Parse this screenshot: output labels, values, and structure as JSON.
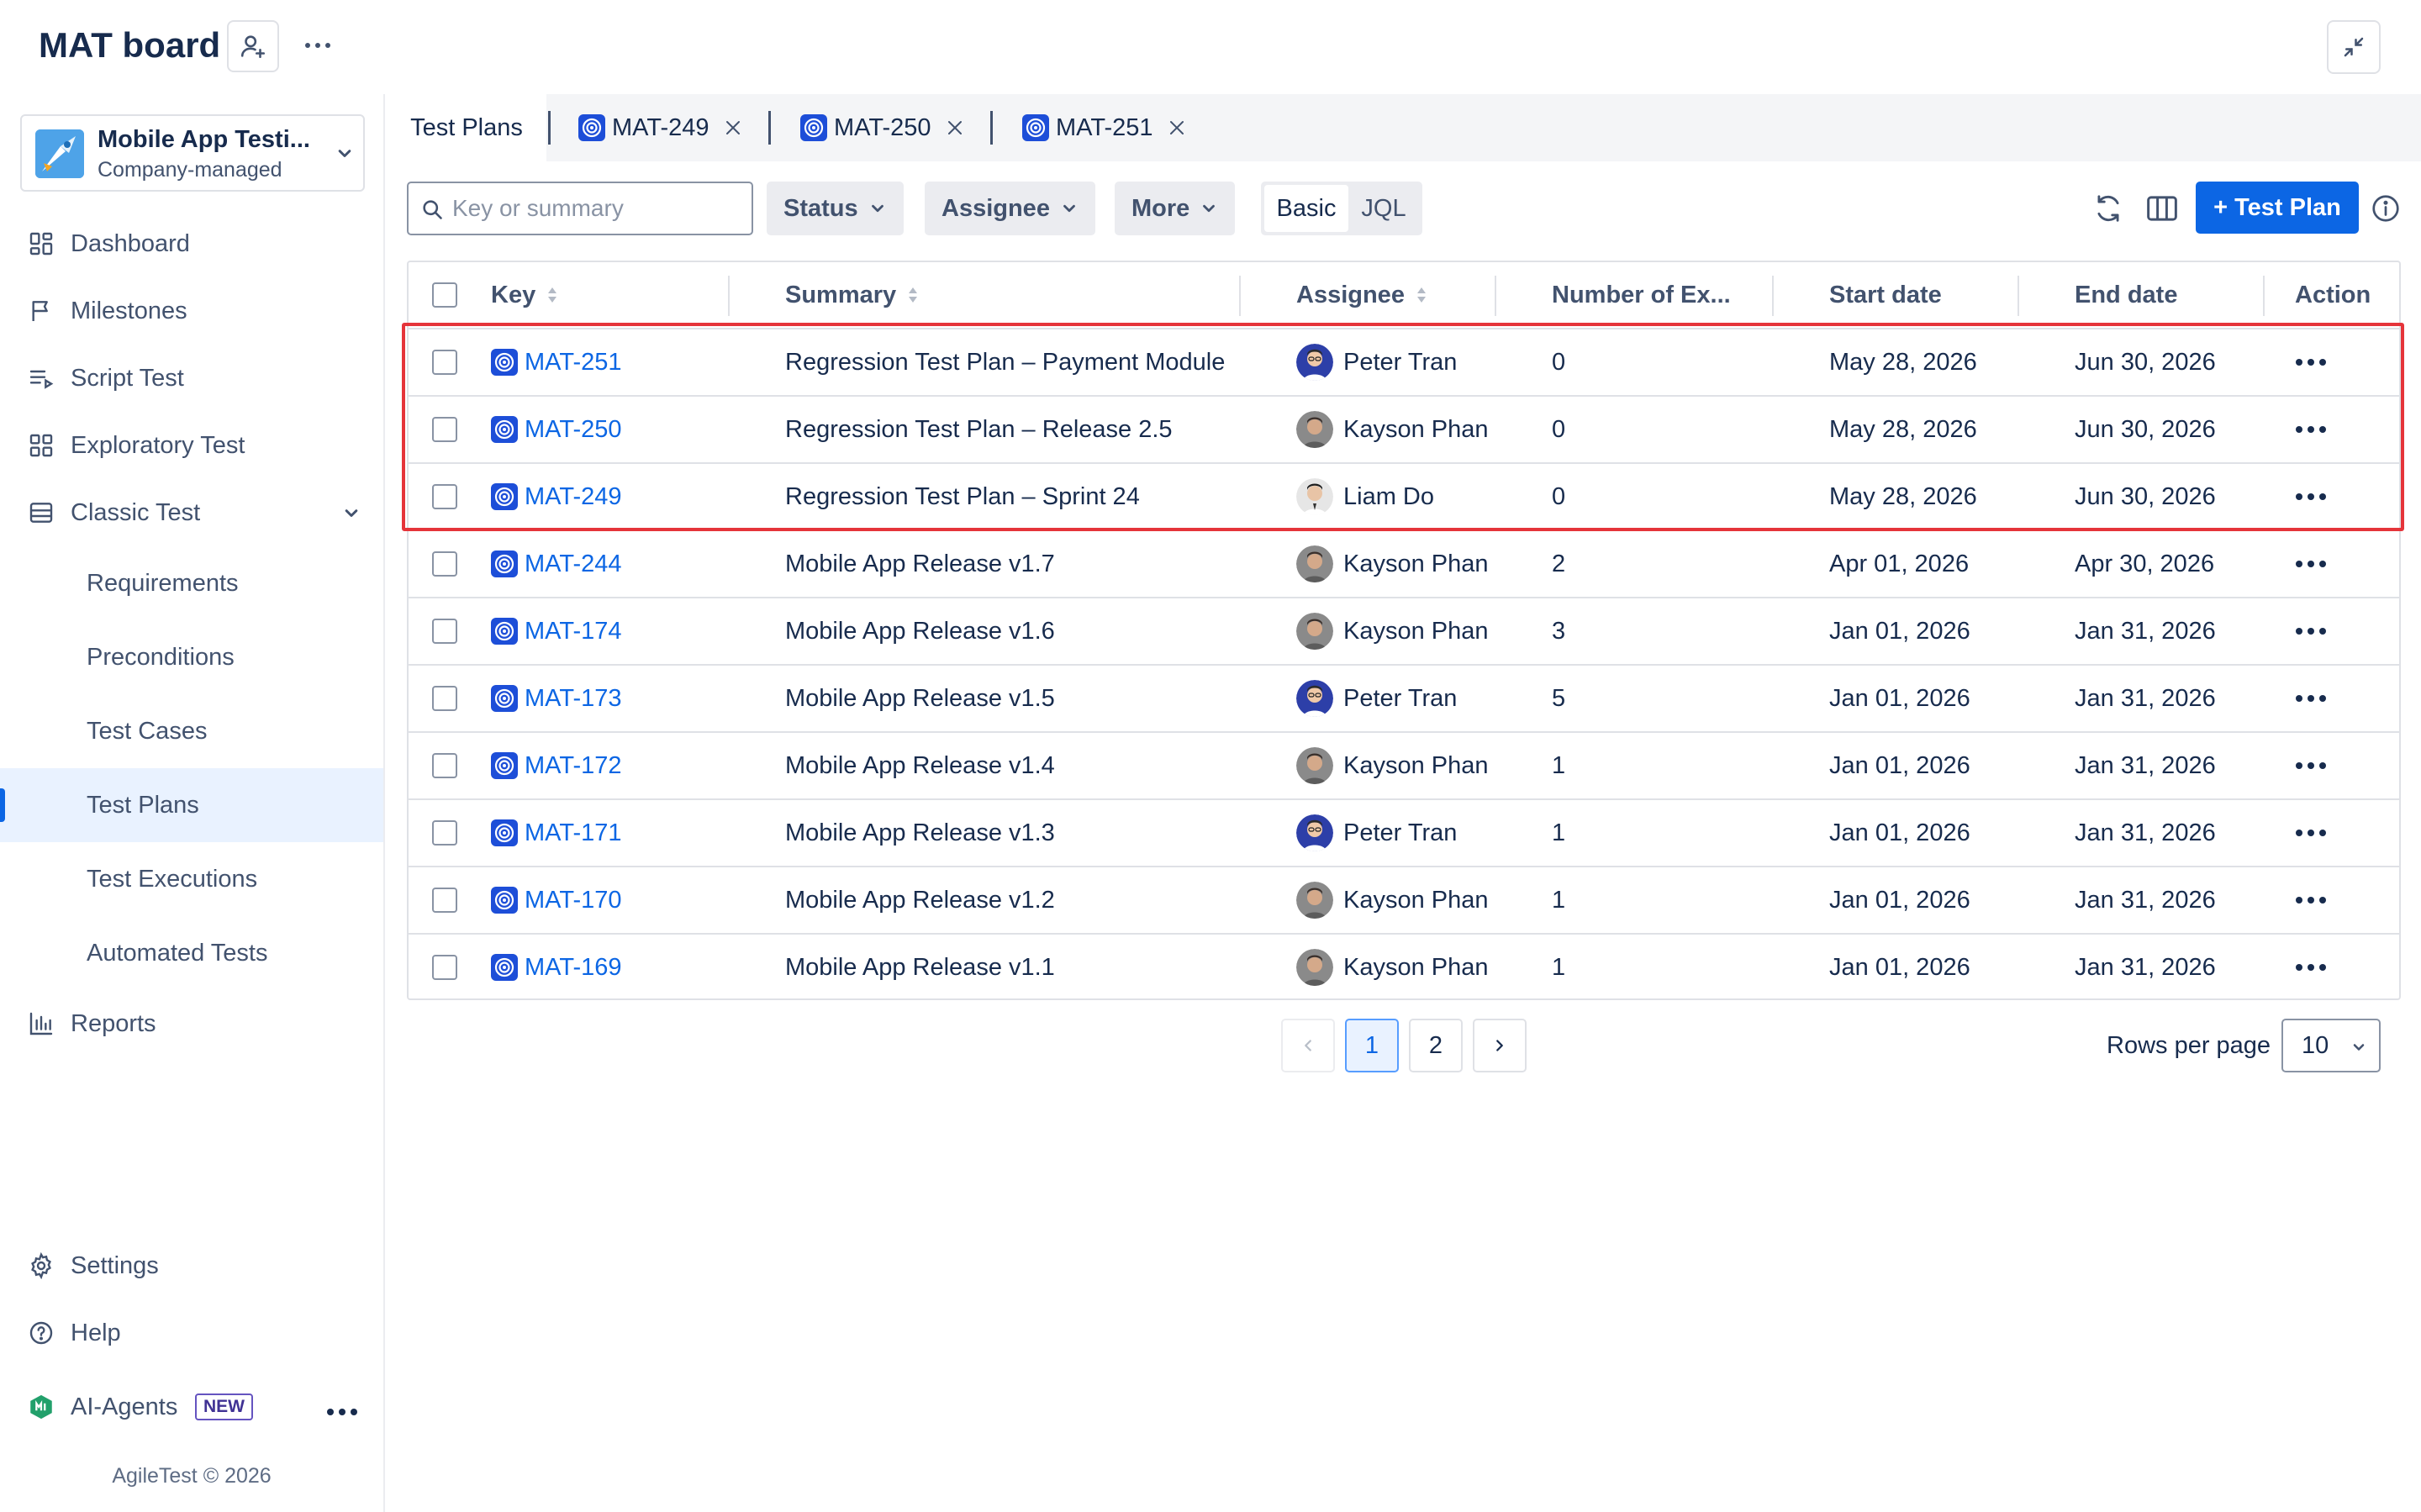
{
  "header": {
    "board_title": "MAT board"
  },
  "project": {
    "name": "Mobile App Testi...",
    "type": "Company-managed"
  },
  "sidebar": {
    "items": [
      {
        "label": "Dashboard",
        "icon": "dashboard-icon"
      },
      {
        "label": "Milestones",
        "icon": "flag-icon"
      },
      {
        "label": "Script Test",
        "icon": "list-icon"
      },
      {
        "label": "Exploratory Test",
        "icon": "grid-icon"
      },
      {
        "label": "Classic Test",
        "icon": "table-icon"
      },
      {
        "label": "Requirements"
      },
      {
        "label": "Preconditions"
      },
      {
        "label": "Test Cases"
      },
      {
        "label": "Test Plans"
      },
      {
        "label": "Test Executions"
      },
      {
        "label": "Automated Tests"
      },
      {
        "label": "Reports",
        "icon": "chart-icon"
      },
      {
        "label": "Settings",
        "icon": "gear-icon"
      },
      {
        "label": "Help",
        "icon": "help-icon"
      },
      {
        "label": "AI-Agents",
        "icon": "ai-agents-icon"
      }
    ],
    "active_item": "Test Plans",
    "new_badge": "NEW",
    "footer": "AgileTest © 2026"
  },
  "tabs": [
    {
      "label": "Test Plans",
      "closable": false
    },
    {
      "label": "MAT-249",
      "closable": true
    },
    {
      "label": "MAT-250",
      "closable": true
    },
    {
      "label": "MAT-251",
      "closable": true
    }
  ],
  "toolbar": {
    "search_placeholder": "Key or summary",
    "filters": [
      "Status",
      "Assignee",
      "More"
    ],
    "mode_basic": "Basic",
    "mode_jql": "JQL",
    "selected_mode": "Basic",
    "primary_button": "+ Test Plan"
  },
  "table": {
    "columns": [
      "Key",
      "Summary",
      "Assignee",
      "Number of Ex...",
      "Start date",
      "End date",
      "Action"
    ],
    "rows": [
      {
        "key": "MAT-251",
        "summary": "Regression Test Plan – Payment Module",
        "assignee": "Peter Tran",
        "executions": "0",
        "start": "May 28, 2026",
        "end": "Jun 30, 2026",
        "highlighted": true
      },
      {
        "key": "MAT-250",
        "summary": "Regression Test Plan – Release 2.5",
        "assignee": "Kayson Phan",
        "executions": "0",
        "start": "May 28, 2026",
        "end": "Jun 30, 2026",
        "highlighted": true
      },
      {
        "key": "MAT-249",
        "summary": "Regression Test Plan – Sprint 24",
        "assignee": "Liam Do",
        "executions": "0",
        "start": "May 28, 2026",
        "end": "Jun 30, 2026",
        "highlighted": true
      },
      {
        "key": "MAT-244",
        "summary": "Mobile App Release v1.7",
        "assignee": "Kayson Phan",
        "executions": "2",
        "start": "Apr 01, 2026",
        "end": "Apr 30, 2026",
        "highlighted": false
      },
      {
        "key": "MAT-174",
        "summary": "Mobile App Release v1.6",
        "assignee": "Kayson Phan",
        "executions": "3",
        "start": "Jan 01, 2026",
        "end": "Jan 31, 2026",
        "highlighted": false
      },
      {
        "key": "MAT-173",
        "summary": "Mobile App Release v1.5",
        "assignee": "Peter Tran",
        "executions": "5",
        "start": "Jan 01, 2026",
        "end": "Jan 31, 2026",
        "highlighted": false
      },
      {
        "key": "MAT-172",
        "summary": "Mobile App Release v1.4",
        "assignee": "Kayson Phan",
        "executions": "1",
        "start": "Jan 01, 2026",
        "end": "Jan 31, 2026",
        "highlighted": false
      },
      {
        "key": "MAT-171",
        "summary": "Mobile App Release v1.3",
        "assignee": "Peter Tran",
        "executions": "1",
        "start": "Jan 01, 2026",
        "end": "Jan 31, 2026",
        "highlighted": false
      },
      {
        "key": "MAT-170",
        "summary": "Mobile App Release v1.2",
        "assignee": "Kayson Phan",
        "executions": "1",
        "start": "Jan 01, 2026",
        "end": "Jan 31, 2026",
        "highlighted": false
      },
      {
        "key": "MAT-169",
        "summary": "Mobile App Release v1.1",
        "assignee": "Kayson Phan",
        "executions": "1",
        "start": "Jan 01, 2026",
        "end": "Jan 31, 2026",
        "highlighted": false
      }
    ]
  },
  "pagination": {
    "pages": [
      "1",
      "2"
    ],
    "current_page": "1",
    "rows_per_page_label": "Rows per page",
    "rows_per_page": "10"
  },
  "colors": {
    "accent": "#0c66e4",
    "highlight_border": "#e5343a",
    "active_nav_bg": "#e9f2ff"
  }
}
